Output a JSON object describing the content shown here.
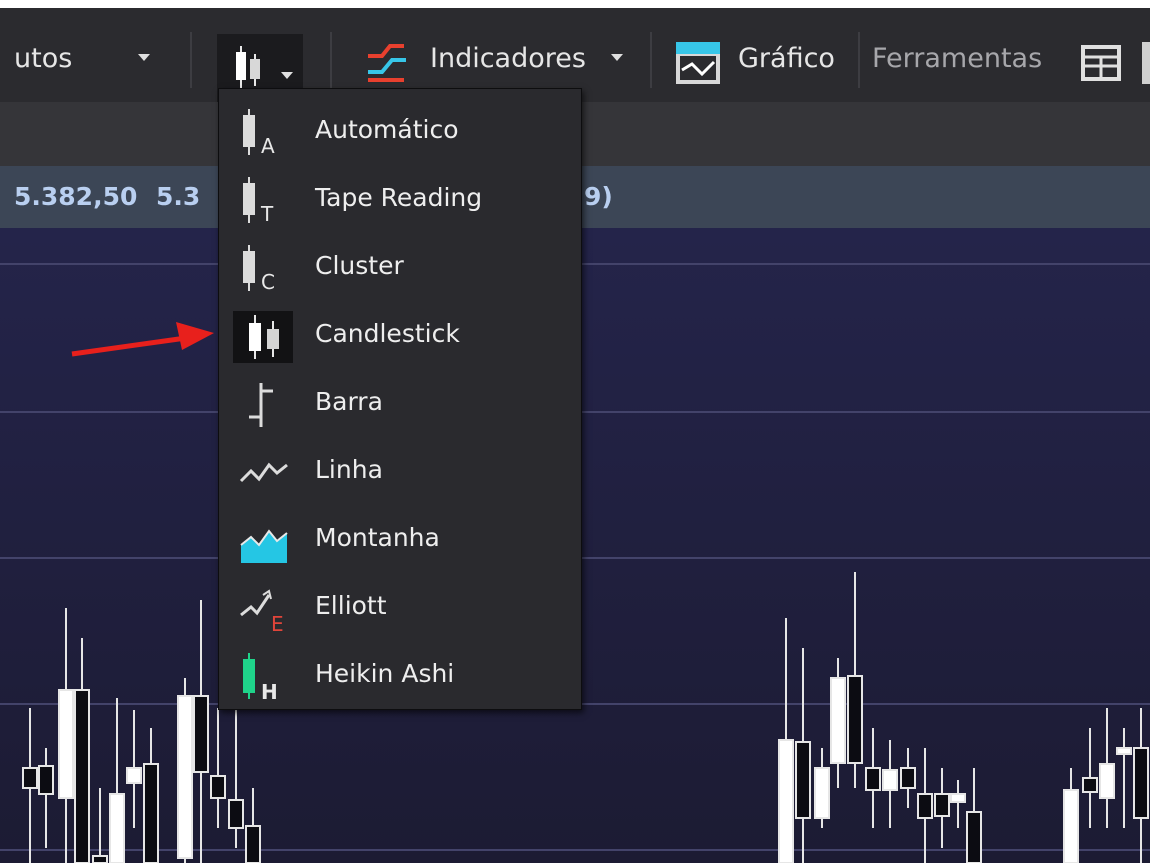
{
  "toolbar": {
    "timeframe_label": "utos",
    "indicators_label": "Indicadores",
    "chart_label": "Gráfico",
    "tools_label": "Ferramentas",
    "chart_type_icon": "candlestick-icon",
    "indicators_icon": "indicators-icon",
    "chart_icon": "chart-window-icon",
    "layout_icon": "layout-grid-icon"
  },
  "price_bar": {
    "value1": "5.382,50",
    "value2": "5.3",
    "value3": "9)"
  },
  "chart_type_menu": {
    "selected": "Candlestick",
    "items": [
      {
        "label": "Automático",
        "icon": "candle-auto-icon",
        "sub": "A"
      },
      {
        "label": "Tape Reading",
        "icon": "candle-tape-reading-icon",
        "sub": "T"
      },
      {
        "label": "Cluster",
        "icon": "candle-cluster-icon",
        "sub": "C"
      },
      {
        "label": "Candlestick",
        "icon": "candlestick-icon",
        "sub": ""
      },
      {
        "label": "Barra",
        "icon": "bar-ohlc-icon",
        "sub": ""
      },
      {
        "label": "Linha",
        "icon": "line-chart-icon",
        "sub": ""
      },
      {
        "label": "Montanha",
        "icon": "mountain-chart-icon",
        "sub": ""
      },
      {
        "label": "Elliott",
        "icon": "elliott-wave-icon",
        "sub": "E"
      },
      {
        "label": "Heikin Ashi",
        "icon": "heikin-ashi-icon",
        "sub": "H"
      }
    ]
  },
  "colors": {
    "toolbar_bg": "#2b2b2f",
    "chart_bg": "#1f1e3a",
    "menu_bg": "#2a2a2e",
    "price_text": "#b9cff0",
    "annotation_arrow": "#e8201c",
    "indicators_icon": "#e8402e",
    "chart_icon": "#37c6e8",
    "mountain_icon": "#25c6e4",
    "elliott_sub": "#e0453a",
    "heikin_icon": "#1fd38a"
  }
}
